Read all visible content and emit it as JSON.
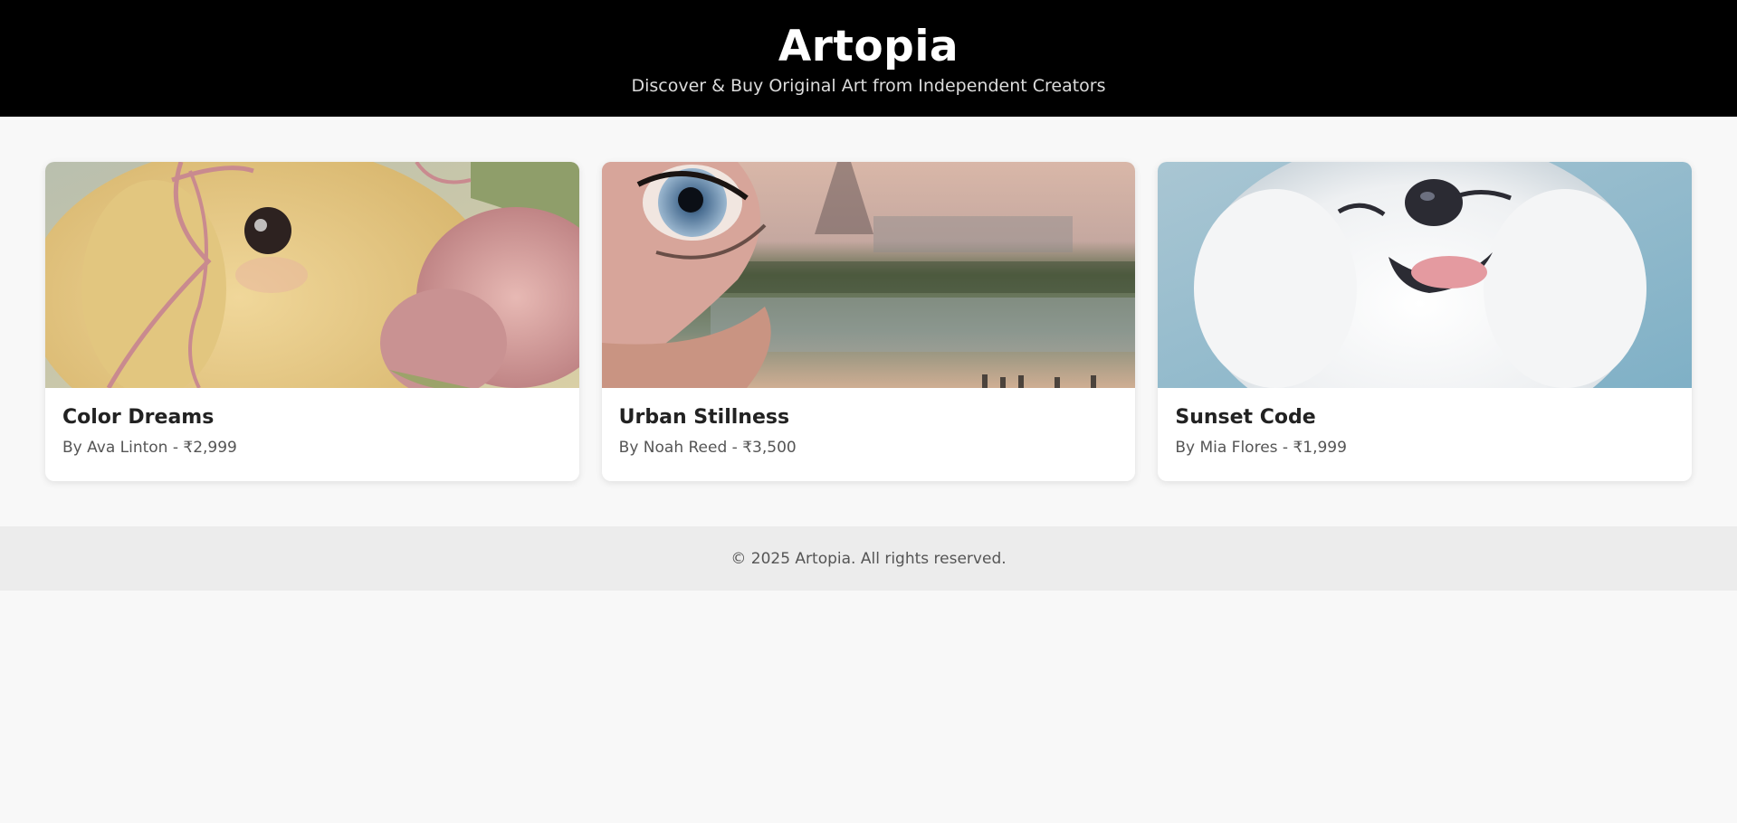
{
  "header": {
    "title": "Artopia",
    "tagline": "Discover & Buy Original Art from Independent Creators"
  },
  "artworks": [
    {
      "title": "Color Dreams",
      "meta": "By Ava Linton - ₹2,999",
      "image": "painting of a yellow puppy with pink bow and peonies"
    },
    {
      "title": "Urban Stillness",
      "meta": "By Noah Reed - ₹3,500",
      "image": "painting of an eye over a Paris riverscape"
    },
    {
      "title": "Sunset Code",
      "meta": "By Mia Flores - ₹1,999",
      "image": "painting of a happy white fluffy dog"
    }
  ],
  "footer": {
    "copyright": "© 2025 Artopia. All rights reserved."
  },
  "colors": {
    "header_bg": "#000000",
    "page_bg": "#f8f8f8",
    "footer_bg": "#ececec"
  }
}
